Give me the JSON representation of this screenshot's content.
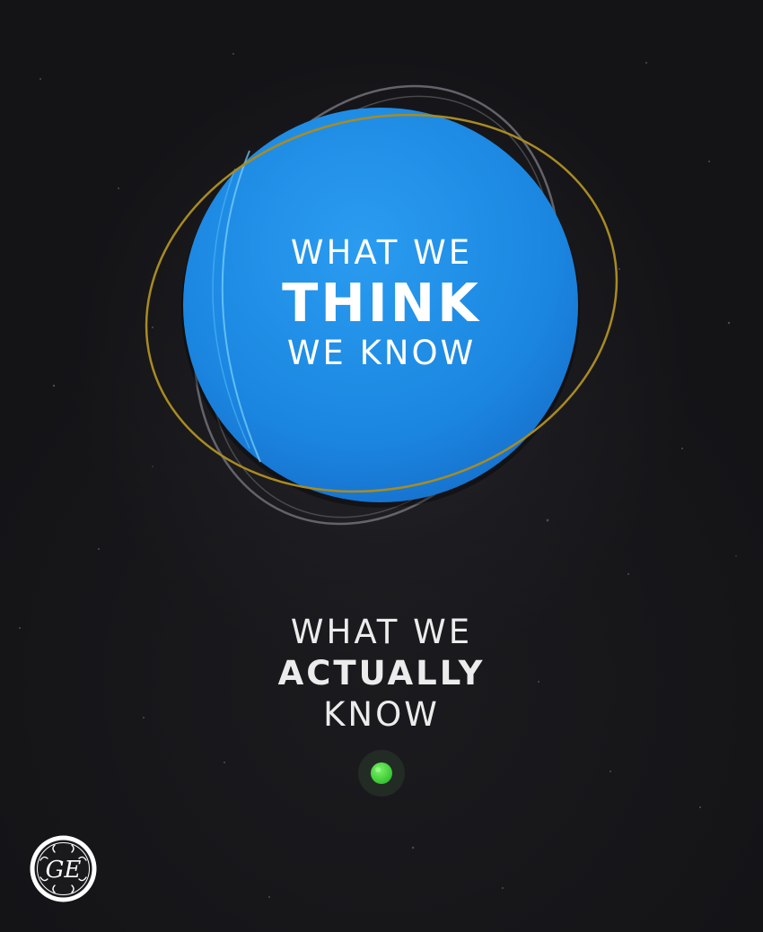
{
  "planet_label": {
    "line1": "WHAT WE",
    "line2": "THINK",
    "line3": "WE KNOW"
  },
  "actual_label": {
    "line1": "WHAT WE",
    "line2": "ACTUALLY",
    "line3": "KNOW"
  },
  "logo_text": "GE",
  "colors": {
    "background": "#141417",
    "planet_blue": "#1c8fe4",
    "gold_orbit": "#b89a2a",
    "gray_orbit": "#7a7a80",
    "dot_green": "#46d63a",
    "text_white": "#ffffff"
  },
  "icons": {
    "dot": "green-dot-icon",
    "logo": "ge-logo"
  }
}
